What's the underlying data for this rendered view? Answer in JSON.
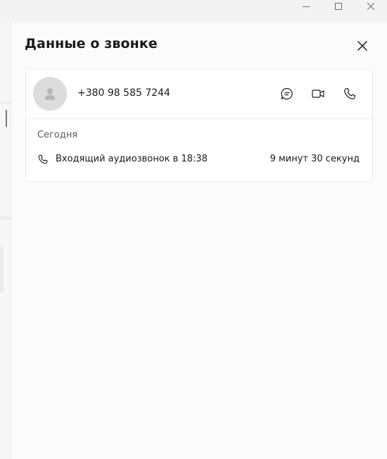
{
  "window": {
    "controls": {
      "minimize": "minimize-icon",
      "maximize": "maximize-icon",
      "close": "close-icon"
    }
  },
  "panel": {
    "title": "Данные о звонке",
    "close_icon": "close-icon"
  },
  "contact": {
    "avatar_icon": "person-icon",
    "phone_number": "+380 98 585 7244",
    "actions": [
      {
        "name": "chat",
        "icon": "chat-icon"
      },
      {
        "name": "video-call",
        "icon": "video-icon"
      },
      {
        "name": "audio-call",
        "icon": "phone-icon"
      }
    ]
  },
  "history": {
    "day": "Сегодня",
    "calls": [
      {
        "icon": "phone-icon",
        "description": "Входящий аудиозвонок в 18:38",
        "duration": "9 минут 30 секунд"
      }
    ]
  }
}
